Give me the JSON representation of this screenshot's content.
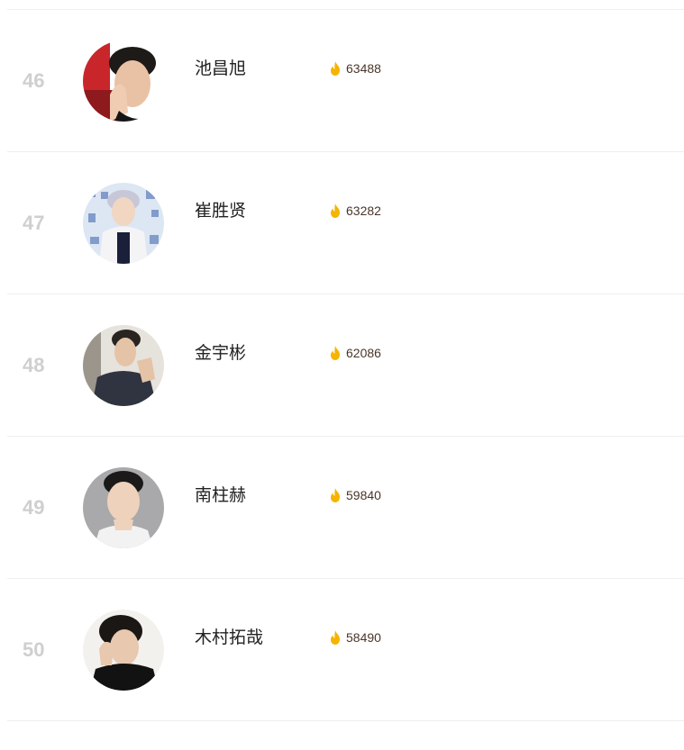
{
  "ranking": {
    "items": [
      {
        "rank": "46",
        "name": "池昌旭",
        "heat": "63488",
        "icon": "fire-icon",
        "photo": "avatar-photo"
      },
      {
        "rank": "47",
        "name": "崔胜贤",
        "heat": "63282",
        "icon": "fire-icon",
        "photo": "avatar-photo"
      },
      {
        "rank": "48",
        "name": "金宇彬",
        "heat": "62086",
        "icon": "fire-icon",
        "photo": "avatar-photo"
      },
      {
        "rank": "49",
        "name": "南柱赫",
        "heat": "59840",
        "icon": "fire-icon",
        "photo": "avatar-photo"
      },
      {
        "rank": "50",
        "name": "木村拓哉",
        "heat": "58490",
        "icon": "fire-icon",
        "photo": "avatar-photo"
      }
    ]
  },
  "colors": {
    "rank_text": "#cfcfcf",
    "name_text": "#222222",
    "heat_text": "#4a3528",
    "fire": "#f5b400",
    "divider": "#efefef"
  }
}
